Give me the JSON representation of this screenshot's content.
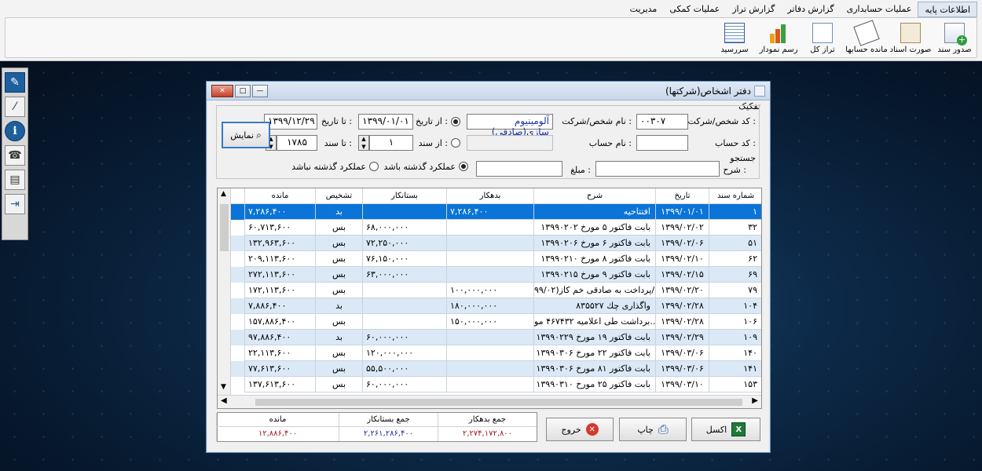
{
  "menu": [
    "اطلاعات پایه",
    "عملیات حسابداری",
    "گزارش دفاتر",
    "گزارش تراز",
    "عملیات کمکی",
    "مدیریت"
  ],
  "ribbon": [
    {
      "label": "صدور سند",
      "icon": "add-document-icon"
    },
    {
      "label": "صورت اسناد",
      "icon": "documents-icon"
    },
    {
      "label": "مانده حسابها",
      "icon": "balances-icon"
    },
    {
      "label": "تراز کل",
      "icon": "ledger-icon"
    },
    {
      "label": "رسم نمودار",
      "icon": "bar-chart-icon"
    },
    {
      "label": "سررسید",
      "icon": "calendar-icon"
    }
  ],
  "window": {
    "title": "دفتر اشخاص(شرکتها)"
  },
  "filter": {
    "section_label": "تفکیک",
    "person_code_label": "کد شخص/شرکت :",
    "person_code_value": "۰۰۳۰۷",
    "person_name_label": "نام شخص/شرکت :",
    "person_name_value": "آلومینیوم سازی(صادقی)",
    "account_code_label": "کد حساب :",
    "account_code_value": "",
    "account_name_label": "نام حساب :",
    "account_name_value": "",
    "from_date_label": "از تاریخ :",
    "from_date_value": "۱۳۹۹/۰۱/۰۱",
    "to_date_label": "تا تاریخ :",
    "to_date_value": "۱۳۹۹/۱۲/۲۹",
    "from_doc_label": "از سند :",
    "from_doc_value": "۱",
    "to_doc_label": "تا سند :",
    "to_doc_value": "۱۷۸۵",
    "search_label": "جستجو",
    "desc_label": "شرح :",
    "desc_value": "",
    "amount_label": "مبلغ :",
    "amount_value": "",
    "with_history_label": "عملکرد گذشته باشد",
    "without_history_label": "عملکرد گذشته نباشد",
    "show_button": "نمایش"
  },
  "table": {
    "columns": [
      "شماره سند",
      "تاریخ",
      "شرح",
      "بدهکار",
      "بستانکار",
      "تشخیص",
      "مانده"
    ],
    "rows": [
      [
        "۱",
        "۱۳۹۹/۰۱/۰۱",
        "افتتاحیه",
        "۷,۲۸۶,۴۰۰",
        "",
        "بد",
        "۷,۲۸۶,۴۰۰"
      ],
      [
        "۳۲",
        "۱۳۹۹/۰۲/۰۲",
        "بابت فاکتور ۵ مورخ ۱۳۹۹۰۲۰۲",
        "",
        "۶۸,۰۰۰,۰۰۰",
        "بس",
        "۶۰,۷۱۳,۶۰۰"
      ],
      [
        "۵۱",
        "۱۳۹۹/۰۲/۰۶",
        "بابت فاکتور ۶ مورخ ۱۳۹۹۰۲۰۶",
        "",
        "۷۲,۲۵۰,۰۰۰",
        "بس",
        "۱۳۲,۹۶۳,۶۰۰"
      ],
      [
        "۶۲",
        "۱۳۹۹/۰۲/۱۰",
        "بابت فاکتور ۸ مورخ ۱۳۹۹۰۲۱۰",
        "",
        "۷۶,۱۵۰,۰۰۰",
        "بس",
        "۲۰۹,۱۱۳,۶۰۰"
      ],
      [
        "۶۹",
        "۱۳۹۹/۰۲/۱۵",
        "بابت فاکتور ۹ مورخ ۱۳۹۹۰۲۱۵",
        "",
        "۶۳,۰۰۰,۰۰۰",
        "بس",
        "۲۷۲,۱۱۳,۶۰۰"
      ],
      [
        "۷۹",
        "۱۳۹۹/۰۲/۲۰",
        "پرداخت به صادقی خم کاز(۹۹/۰۲/...",
        "۱۰۰,۰۰۰,۰۰۰",
        "",
        "بس",
        "۱۷۲,۱۱۳,۶۰۰"
      ],
      [
        "۱۰۴",
        "۱۳۹۹/۰۲/۲۸",
        "واگذاری چك ۸۳۵۵۲۷",
        "۱۸۰,۰۰۰,۰۰۰",
        "",
        "بد",
        "۷,۸۸۶,۴۰۰"
      ],
      [
        "۱۰۶",
        "۱۳۹۹/۰۲/۲۸",
        "برداشت طی اعلامیه ۴۶۷۴۳۲ مو...",
        "۱۵۰,۰۰۰,۰۰۰",
        "",
        "بس",
        "۱۵۷,۸۸۶,۴۰۰"
      ],
      [
        "۱۰۹",
        "۱۳۹۹/۰۲/۲۹",
        "بابت فاکتور ۱۹ مورخ ۱۳۹۹۰۲۲۹",
        "",
        "۶۰,۰۰۰,۰۰۰",
        "بد",
        "۹۷,۸۸۶,۴۰۰"
      ],
      [
        "۱۴۰",
        "۱۳۹۹/۰۳/۰۶",
        "بابت فاکتور ۲۲ مورخ ۱۳۹۹۰۳۰۶",
        "",
        "۱۲۰,۰۰۰,۰۰۰",
        "بس",
        "۲۲,۱۱۳,۶۰۰"
      ],
      [
        "۱۴۱",
        "۱۳۹۹/۰۳/۰۶",
        "بابت فاکتور ۸۱ مورخ ۱۳۹۹۰۳۰۶",
        "",
        "۵۵,۵۰۰,۰۰۰",
        "بس",
        "۷۷,۶۱۳,۶۰۰"
      ],
      [
        "۱۵۳",
        "۱۳۹۹/۰۳/۱۰",
        "بابت فاکتور ۲۵ مورخ ۱۳۹۹۰۳۱۰",
        "",
        "۶۰,۰۰۰,۰۰۰",
        "بس",
        "۱۳۷,۶۱۳,۶۰۰"
      ]
    ]
  },
  "totals": {
    "debit_label": "جمع بدهکار",
    "debit_value": "۲,۲۷۴,۱۷۲,۸۰۰",
    "credit_label": "جمع بستانکار",
    "credit_value": "۲,۲۶۱,۲۸۶,۴۰۰",
    "remain_label": "مانده",
    "remain_value": "۱۲,۸۸۶,۴۰۰"
  },
  "buttons": {
    "excel": "اکسل",
    "print": "چاپ",
    "exit": "خروج"
  },
  "colors": {
    "selected_row": "#0a74d8",
    "alt_row": "#dbe8f6",
    "debit_total": "#a3171b",
    "credit_total": "#1b2fa3"
  }
}
